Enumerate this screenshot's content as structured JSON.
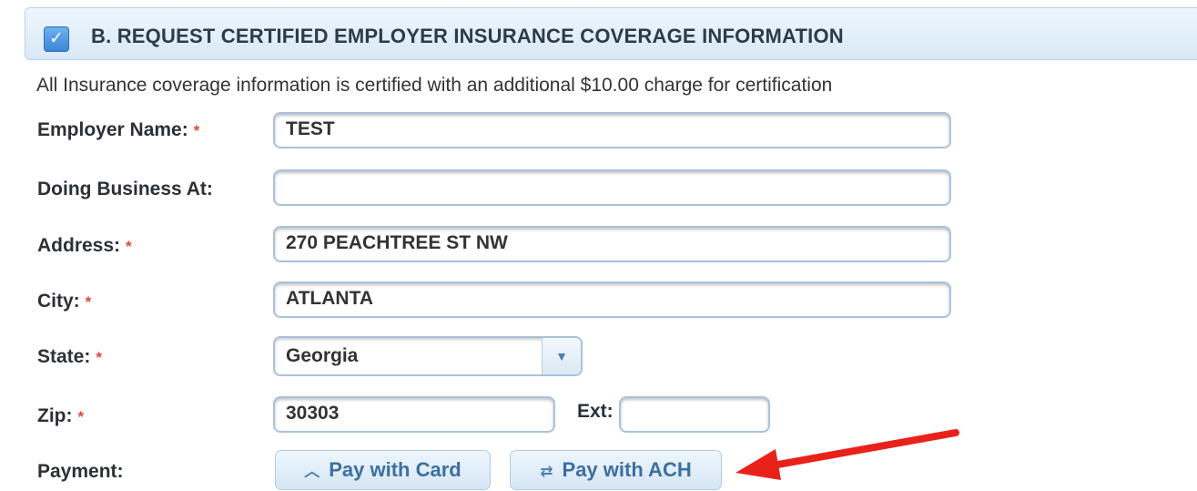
{
  "section": {
    "checked": true,
    "title": "B. REQUEST CERTIFIED EMPLOYER INSURANCE COVERAGE INFORMATION",
    "notice": "All Insurance coverage information is certified with an additional $10.00 charge for certification"
  },
  "form": {
    "employer_name": {
      "label": "Employer Name:",
      "value": "TEST",
      "required_mark": "*"
    },
    "doing_business_at": {
      "label": "Doing Business At:",
      "value": ""
    },
    "address": {
      "label": "Address:",
      "value": "270 PEACHTREE ST NW",
      "required_mark": "*"
    },
    "city": {
      "label": "City:",
      "value": "ATLANTA",
      "required_mark": "*"
    },
    "state": {
      "label": "State:",
      "value": "Georgia",
      "required_mark": "*"
    },
    "zip": {
      "label": "Zip:",
      "value": "30303",
      "required_mark": "*"
    },
    "ext": {
      "label": "Ext:",
      "value": ""
    },
    "payment": {
      "label": "Payment:",
      "card_button": "Pay with Card",
      "ach_button": "Pay with ACH"
    }
  },
  "colors": {
    "accent": "#3c86d6",
    "required": "#e0453f",
    "annotation_arrow": "#e8221b"
  },
  "icons": {
    "card_button_icon": "chevron-up-icon",
    "ach_button_icon": "swap-arrows-icon",
    "state_dropdown_icon": "chevron-down-icon"
  }
}
